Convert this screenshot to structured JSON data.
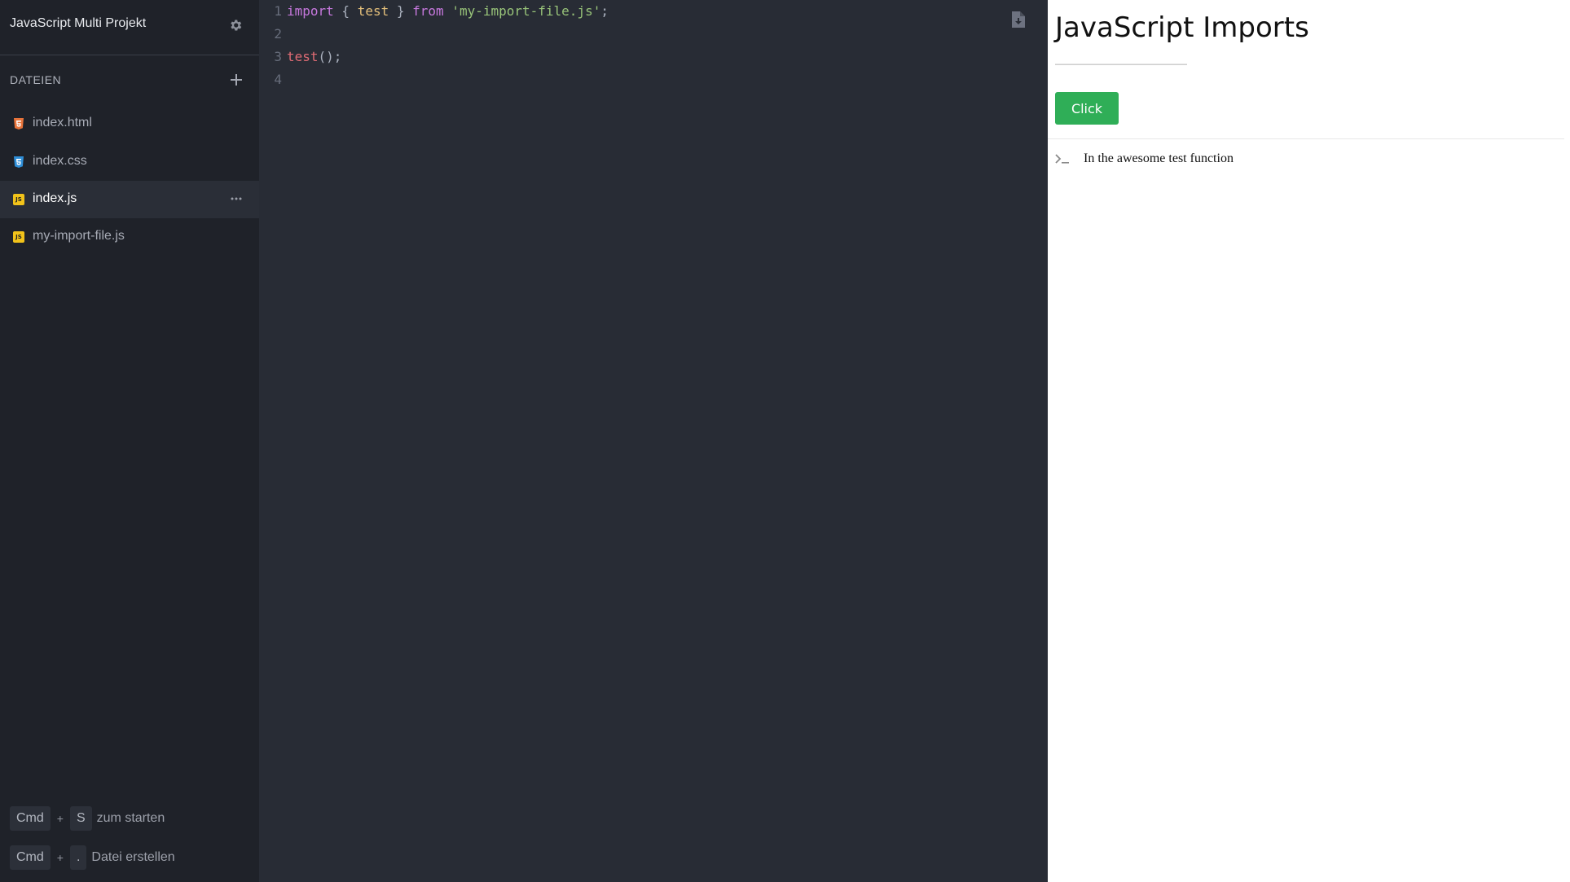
{
  "sidebar": {
    "project_title": "JavaScript Multi Projekt",
    "files_heading": "DATEIEN",
    "files": [
      {
        "name": "index.html",
        "type": "html",
        "icon": "html5-file-icon",
        "color": "#e8743b"
      },
      {
        "name": "index.css",
        "type": "css",
        "icon": "css3-file-icon",
        "color": "#2f8fd8"
      },
      {
        "name": "index.js",
        "type": "js",
        "icon": "js-file-icon",
        "color": "#f2c31a",
        "active": true
      },
      {
        "name": "my-import-file.js",
        "type": "js",
        "icon": "js-file-icon",
        "color": "#f2c31a"
      }
    ],
    "shortcuts": [
      {
        "key1": "Cmd",
        "plus": "+",
        "key2": "S",
        "text": "zum starten"
      },
      {
        "key1": "Cmd",
        "plus": "+",
        "key2": ".",
        "text": "Datei erstellen"
      }
    ]
  },
  "editor": {
    "line_numbers": [
      "1",
      "2",
      "3",
      "4"
    ],
    "line1": {
      "kw_import": "import",
      "open_brace": " { ",
      "ident": "test",
      "close_brace": " } ",
      "kw_from": "from",
      "space": " ",
      "str": "'my-import-file.js'",
      "semi": ";"
    },
    "line3": {
      "fn": "test",
      "rest": "();"
    }
  },
  "preview": {
    "title": "JavaScript Imports",
    "button_label": "Click",
    "console_message": "In the awesome test function"
  },
  "colors": {
    "sidebar_bg": "#1f2229",
    "editor_bg": "#282c35",
    "button_green": "#2fae57"
  }
}
